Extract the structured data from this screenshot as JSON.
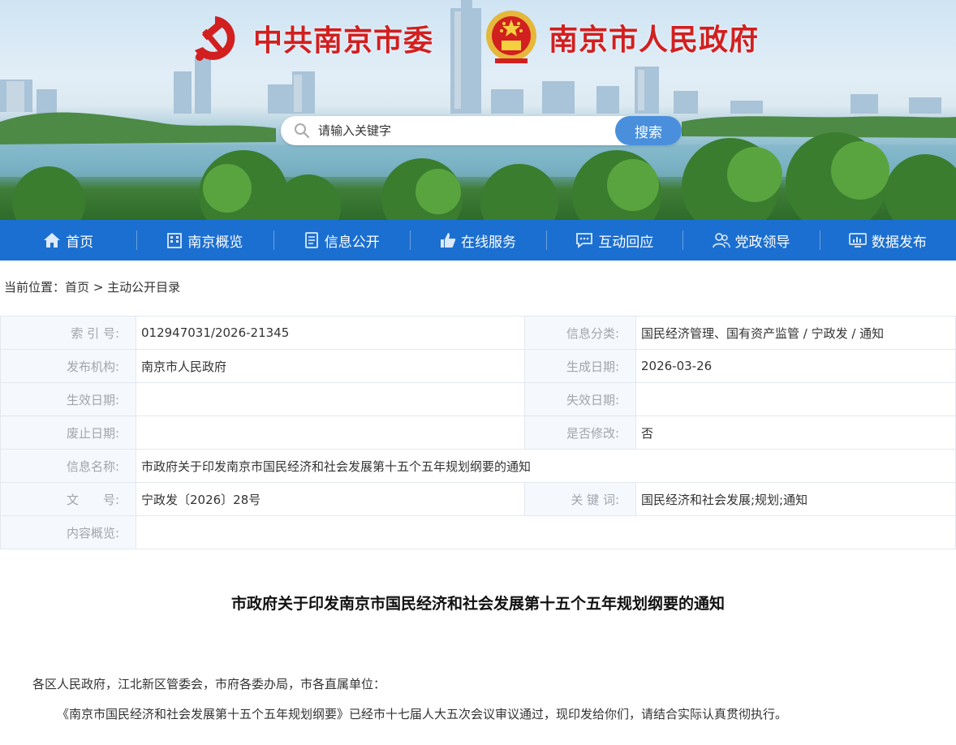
{
  "header": {
    "party_title": "中共南京市委",
    "gov_title": "南京市人民政府",
    "search": {
      "placeholder": "请输入关键字",
      "button": "搜索"
    }
  },
  "nav": {
    "items": [
      {
        "label": "首页",
        "icon": "home-icon"
      },
      {
        "label": "南京概览",
        "icon": "building-icon"
      },
      {
        "label": "信息公开",
        "icon": "document-icon"
      },
      {
        "label": "在线服务",
        "icon": "thumbs-up-icon"
      },
      {
        "label": "互动回应",
        "icon": "chat-icon"
      },
      {
        "label": "党政领导",
        "icon": "people-icon"
      },
      {
        "label": "数据发布",
        "icon": "monitor-chart-icon"
      }
    ]
  },
  "breadcrumb": {
    "prefix": "当前位置：",
    "home": "首页",
    "sep": ">",
    "current": "主动公开目录"
  },
  "meta": {
    "index_label": "索 引 号:",
    "index_value": "012947031/2026-21345",
    "category_label": "信息分类:",
    "category_value": "国民经济管理、国有资产监管 / 宁政发 / 通知",
    "org_label": "发布机构:",
    "org_value": "南京市人民政府",
    "created_label": "生成日期:",
    "created_value": "2026-03-26",
    "effective_label": "生效日期:",
    "effective_value": "",
    "expire_label": "失效日期:",
    "expire_value": "",
    "abolish_label": "废止日期:",
    "abolish_value": "",
    "modified_label": "是否修改:",
    "modified_value": "否",
    "name_label": "信息名称:",
    "name_value": "市政府关于印发南京市国民经济和社会发展第十五个五年规划纲要的通知",
    "docno_label": "文　　号:",
    "docno_value": "宁政发〔2026〕28号",
    "keyword_label": "关 键 词:",
    "keyword_value": "国民经济和社会发展;规划;通知",
    "summary_label": "内容概览:",
    "summary_value": ""
  },
  "article": {
    "title": "市政府关于印发南京市国民经济和社会发展第十五个五年规划纲要的通知",
    "salutation": "各区人民政府，江北新区管委会，市府各委办局，市各直属单位：",
    "body": "《南京市国民经济和社会发展第十五个五年规划纲要》已经市十七届人大五次会议审议通过，现印发给你们，请结合实际认真贯彻执行。"
  },
  "colors": {
    "nav": "#1b6fd0",
    "search_button": "#4a8fdc",
    "title_red": "#d21f1f"
  }
}
